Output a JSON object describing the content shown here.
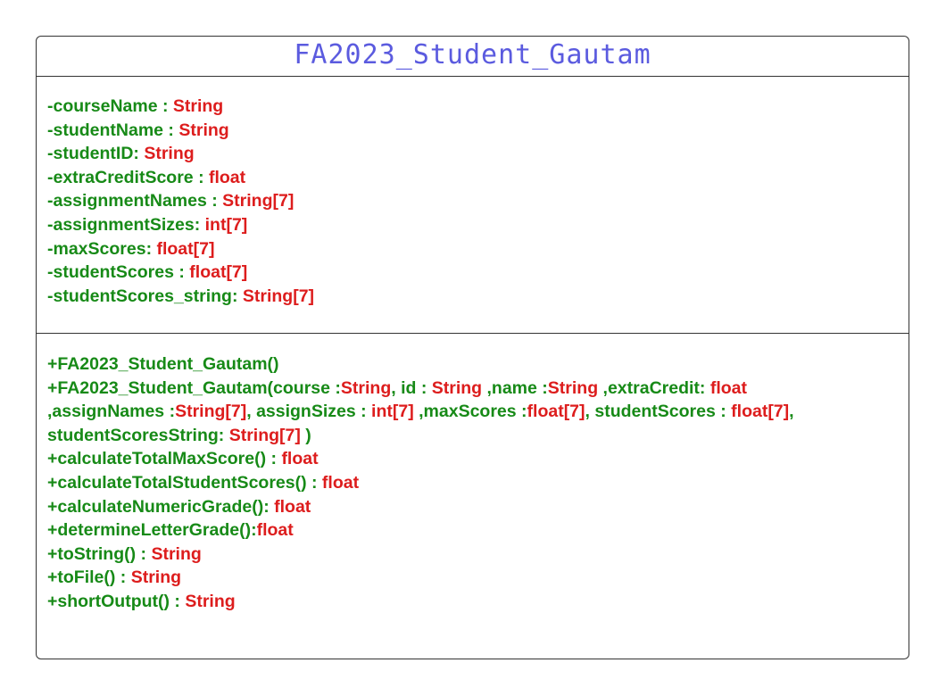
{
  "colors": {
    "name": "#5b5bdf",
    "green": "#178a17",
    "red": "#dd1d1d",
    "border": "#333333"
  },
  "class_name": "FA2023_Student_Gautam",
  "attributes": [
    [
      [
        "g",
        "-courseName : "
      ],
      [
        "r",
        "String"
      ]
    ],
    [
      [
        "g",
        "-studentName : "
      ],
      [
        "r",
        "String"
      ]
    ],
    [
      [
        "g",
        "-studentID: "
      ],
      [
        "r",
        "String"
      ]
    ],
    [
      [
        "g",
        "-extraCreditScore : "
      ],
      [
        "r",
        "float"
      ]
    ],
    [
      [
        "g",
        "-assignmentNames : "
      ],
      [
        "r",
        "String[7]"
      ]
    ],
    [
      [
        "g",
        "-assignmentSizes: "
      ],
      [
        "r",
        "int[7]"
      ]
    ],
    [
      [
        "g",
        "-maxScores: "
      ],
      [
        "r",
        "float[7]"
      ]
    ],
    [
      [
        "g",
        "-studentScores : "
      ],
      [
        "r",
        "float[7]"
      ]
    ],
    [
      [
        "g",
        "-studentScores_string: "
      ],
      [
        "r",
        "String[7]"
      ]
    ]
  ],
  "operations": [
    [
      [
        "g",
        "+FA2023_Student_Gautam()"
      ]
    ],
    [
      [
        "g",
        "+FA2023_Student_Gautam(course :"
      ],
      [
        "r",
        "String"
      ],
      [
        "g",
        ", id : "
      ],
      [
        "r",
        "String"
      ],
      [
        "g",
        " ,name :"
      ],
      [
        "r",
        "String"
      ],
      [
        "g",
        " ,extraCredit: "
      ],
      [
        "r",
        "float"
      ]
    ],
    [
      [
        "g",
        ",assignNames :"
      ],
      [
        "r",
        "String[7]"
      ],
      [
        "g",
        ", assignSizes : "
      ],
      [
        "r",
        "int[7]"
      ],
      [
        "g",
        " ,maxScores :"
      ],
      [
        "r",
        "float[7]"
      ],
      [
        "g",
        ", studentScores : "
      ],
      [
        "r",
        "float[7]"
      ],
      [
        "g",
        ","
      ]
    ],
    [
      [
        "g",
        "studentScoresString: "
      ],
      [
        "r",
        "String[7]"
      ],
      [
        "g",
        " )"
      ]
    ],
    [
      [
        "g",
        "+calculateTotalMaxScore() : "
      ],
      [
        "r",
        "float"
      ]
    ],
    [
      [
        "g",
        "+calculateTotalStudentScores() : "
      ],
      [
        "r",
        "float"
      ]
    ],
    [
      [
        "g",
        "+calculateNumericGrade(): "
      ],
      [
        "r",
        "float"
      ]
    ],
    [
      [
        "g",
        "+determineLetterGrade():"
      ],
      [
        "r",
        "float"
      ]
    ],
    [
      [
        "g",
        "+toString() : "
      ],
      [
        "r",
        "String"
      ]
    ],
    [
      [
        "g",
        "+toFile() : "
      ],
      [
        "r",
        "String"
      ]
    ],
    [
      [
        "g",
        "+shortOutput() : "
      ],
      [
        "r",
        "String"
      ]
    ]
  ]
}
